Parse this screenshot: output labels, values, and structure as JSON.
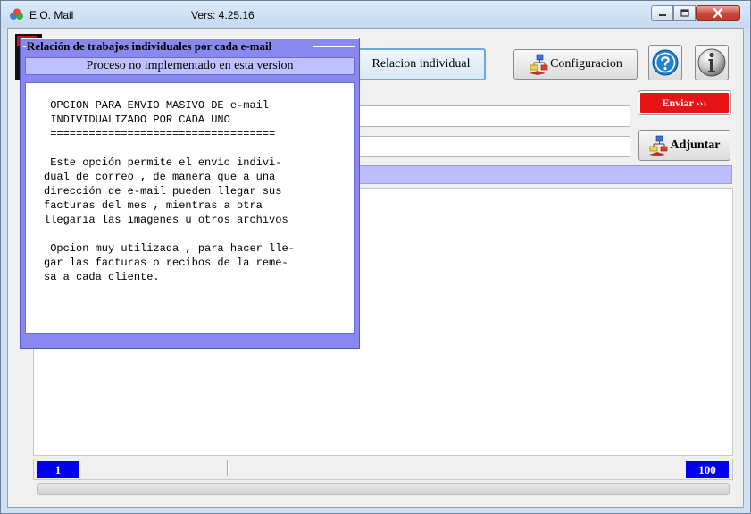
{
  "window": {
    "title": "E.O. Mail",
    "version": "Vers: 4.25.16",
    "controls": {
      "minimize_icon": "minimize-icon",
      "maximize_icon": "maximize-icon",
      "close_icon": "close-icon"
    }
  },
  "toolbar": {
    "relacion_label": "Relacion individual",
    "config_label": "Configuracion",
    "enviar_label": "Enviar ›››",
    "adjuntar_label": "Adjuntar",
    "help_icon": "help-icon",
    "info_icon": "info-icon",
    "enviar_color": "#e61414"
  },
  "dialog": {
    "title": "Relación de trabajos individuales por cada e-mail",
    "header": "Proceso no implementado en esta version",
    "body_lines": [
      "OPCION PARA ENVIO MASIVO DE e-mail",
      "INDIVIDUALIZADO POR CADA UNO",
      "===================================",
      "",
      "Este opción permite el envio indivi-",
      "dual de correo , de manera que a una",
      "dirección de e-mail pueden llegar sus",
      "facturas del mes , mientras a otra",
      "llegaria las imagenes u otros archivos",
      "",
      "Opcion muy utilizada , para hacer lle-",
      "gar las facturas o recibos de la reme-",
      "sa a cada cliente."
    ]
  },
  "status": {
    "left_value": "1",
    "right_value": "100",
    "badge_color": "#0000ee"
  },
  "colors": {
    "dialog_frame": "#8888ee",
    "dialog_header": "#c0c0ff",
    "band": "#bebeff"
  }
}
